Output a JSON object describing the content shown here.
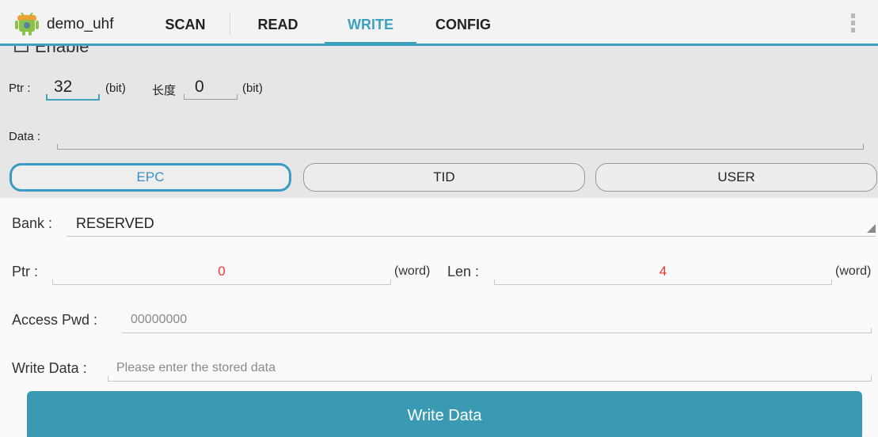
{
  "app": {
    "title": "demo_uhf",
    "icon": "android-icon",
    "tabs": [
      {
        "label": "SCAN",
        "active": false
      },
      {
        "label": "READ",
        "active": false
      },
      {
        "label": "WRITE",
        "active": true
      },
      {
        "label": "CONFIG",
        "active": false
      }
    ],
    "overflow_icon": "overflow-menu-icon",
    "accent_color": "#3ea1bd"
  },
  "filter": {
    "enable_label": "Enable",
    "enable_checked": false,
    "ptr_label": "Ptr :",
    "ptr_value": "32",
    "ptr_unit": "(bit)",
    "length_label": "长度",
    "length_value": "0",
    "length_unit": "(bit)",
    "data_label": "Data :",
    "data_value": ""
  },
  "bank_buttons": [
    {
      "label": "EPC",
      "selected": true
    },
    {
      "label": "TID",
      "selected": false
    },
    {
      "label": "USER",
      "selected": false
    }
  ],
  "write_form": {
    "bank_label": "Bank :",
    "bank_value": "RESERVED",
    "ptr_label": "Ptr :",
    "ptr_value": "0",
    "ptr_unit": "(word)",
    "len_label": "Len :",
    "len_value": "4",
    "len_unit": "(word)",
    "access_pwd_label": "Access Pwd :",
    "access_pwd_value": "00000000",
    "write_data_label": "Write Data :",
    "write_data_placeholder": "Please enter the stored data",
    "write_button_label": "Write Data"
  }
}
